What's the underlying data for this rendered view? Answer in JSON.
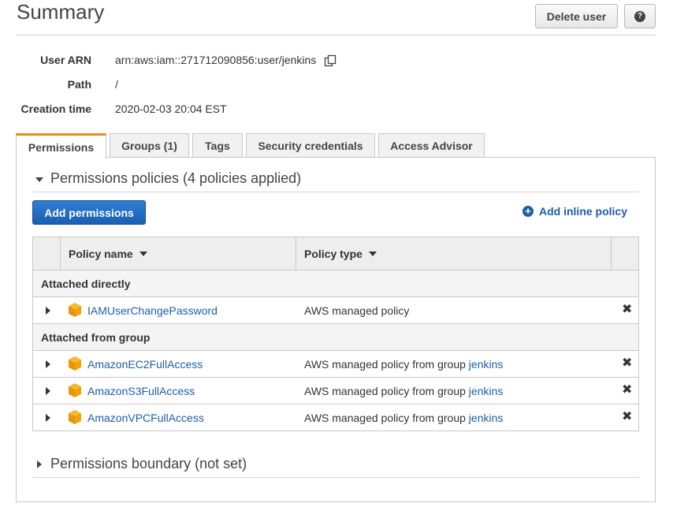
{
  "header": {
    "title": "Summary",
    "delete_label": "Delete user",
    "help_glyph": "?"
  },
  "summary": {
    "user_arn_label": "User ARN",
    "user_arn_value": "arn:aws:iam::271712090856:user/jenkins",
    "path_label": "Path",
    "path_value": "/",
    "creation_label": "Creation time",
    "creation_value": "2020-02-03 20:04 EST"
  },
  "tabs": [
    {
      "label": "Permissions",
      "active": true
    },
    {
      "label": "Groups (1)",
      "active": false
    },
    {
      "label": "Tags",
      "active": false
    },
    {
      "label": "Security credentials",
      "active": false
    },
    {
      "label": "Access Advisor",
      "active": false
    }
  ],
  "permissions": {
    "section_title": "Permissions policies (4 policies applied)",
    "add_permissions_label": "Add permissions",
    "add_inline_label": "Add inline policy",
    "columns": {
      "policy_name": "Policy name",
      "policy_type": "Policy type"
    },
    "groups": [
      {
        "label": "Attached directly",
        "rows": [
          {
            "name": "IAMUserChangePassword",
            "type": "AWS managed policy",
            "group_link": ""
          }
        ]
      },
      {
        "label": "Attached from group",
        "rows": [
          {
            "name": "AmazonEC2FullAccess",
            "type": "AWS managed policy from group ",
            "group_link": "jenkins"
          },
          {
            "name": "AmazonS3FullAccess",
            "type": "AWS managed policy from group ",
            "group_link": "jenkins"
          },
          {
            "name": "AmazonVPCFullAccess",
            "type": "AWS managed policy from group ",
            "group_link": "jenkins"
          }
        ]
      }
    ],
    "remove_glyph": "✖"
  },
  "boundary": {
    "section_title": "Permissions boundary (not set)"
  },
  "colors": {
    "accent_tab": "#e88b1d",
    "link": "#1f5da8",
    "primary_button": "#1f6bc2",
    "policy_icon": "#f0a30a"
  },
  "icons": [
    "help-icon",
    "copy-icon",
    "plus-circle-icon",
    "policy-cube-icon",
    "remove-icon",
    "expand-arrow-icon",
    "collapse-arrow-icon",
    "sort-caret-icon"
  ]
}
